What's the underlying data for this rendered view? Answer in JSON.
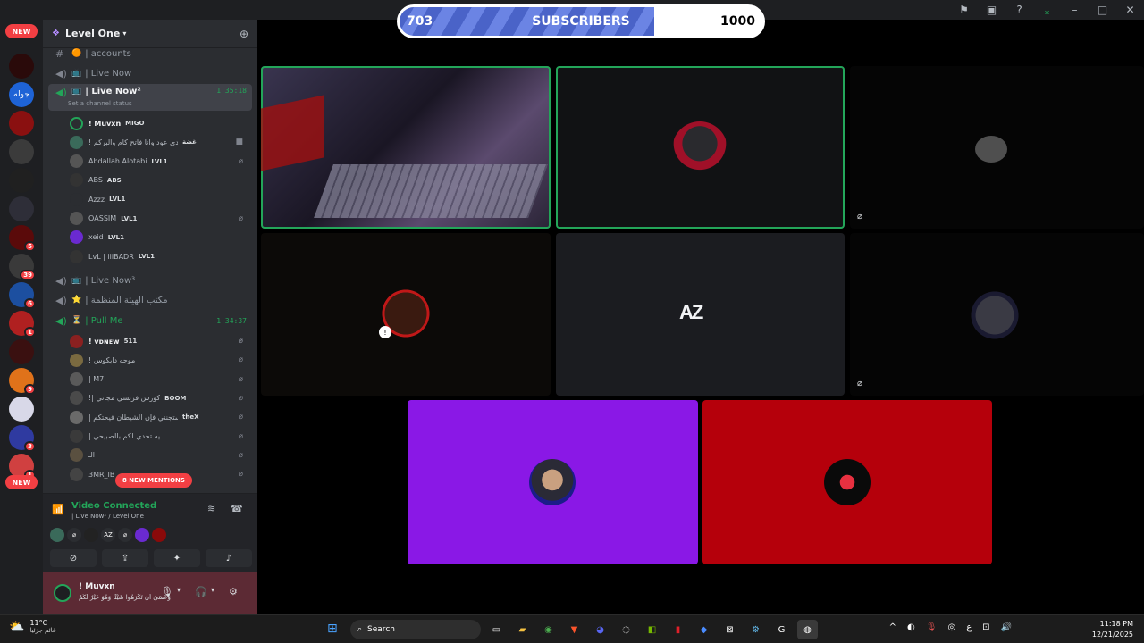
{
  "subscriber_bar": {
    "count": "703",
    "label": "SUBSCRIBERS",
    "goal": "1000",
    "progress": 0.703
  },
  "server": {
    "name": "Level One"
  },
  "server_rail": {
    "new_top": "NEW",
    "new_bottom": "NEW",
    "badges": [
      "5",
      "39",
      "6",
      "1",
      "9",
      "3",
      "1"
    ]
  },
  "channels": {
    "accounts": "| accounts",
    "live_now": "| Live Now",
    "live_now2": "| Live Now²",
    "live_now2_timer": "1:35:18",
    "live_now2_status": "Set a channel status",
    "live_now3": "| Live Now³",
    "office": "| مكتب الهيئة المنظمة",
    "pull_me": "| Pull Me",
    "pull_me_timer": "1:34:37"
  },
  "voice_users_1": [
    {
      "name": "! Muvxn",
      "tag": "MIGO"
    },
    {
      "name": "! بدي عود وانا فاتح كام والبركم",
      "tag": "غضة"
    },
    {
      "name": "Abdallah Alotabi",
      "tag": "LVL1"
    },
    {
      "name": "ABS",
      "tag": "ABS"
    },
    {
      "name": "Azzz",
      "tag": "LVL1"
    },
    {
      "name": "QASSIM",
      "tag": "LVL1"
    },
    {
      "name": "xeid",
      "tag": "LVL1"
    },
    {
      "name": "LvL | iiiBADR",
      "tag": "LVL1"
    }
  ],
  "voice_users_2": [
    {
      "name": "! ᴠᴅɴᴇᴡ",
      "tag": "511"
    },
    {
      "name": "! موجه دايكوس",
      "tag": ""
    },
    {
      "name": "| M7",
      "tag": ""
    },
    {
      "name": "!| كورس فرنسي مجاني",
      "tag": "BOOM"
    },
    {
      "name": "| دائما ستجنني فإن الشيطان فيحتكم",
      "tag": "theX"
    },
    {
      "name": "| يه تحدي لكم بالصبيحي",
      "tag": ""
    },
    {
      "name": "الـ",
      "tag": ""
    },
    {
      "name": "3MR_IB",
      "tag": ""
    }
  ],
  "mentions_pill": "8 NEW MENTIONS",
  "voice_panel": {
    "title": "Video Connected",
    "subtitle": "| Live Now² / Level One"
  },
  "user_panel": {
    "name": "! Muvxn",
    "status": "وَعَسَىٰ أَن تَكْرَهُوا شَيْئًا وَهُوَ خَيْرٌ لَّكُمْ"
  },
  "taskbar": {
    "temp": "11°C",
    "weather_desc": "غائم جزئيا",
    "search": "Search",
    "lang": "ع",
    "time": "11:18 PM",
    "date": "12/21/2025"
  },
  "colors": {
    "purple_tile": "#8a18e6",
    "red_tile": "#b5000b",
    "speaking": "#23a559",
    "mentions": "#f23f43"
  },
  "icons": [
    "flag-icon",
    "inbox-icon",
    "help-icon",
    "download-icon",
    "minimize-icon",
    "maximize-icon",
    "close-icon"
  ]
}
